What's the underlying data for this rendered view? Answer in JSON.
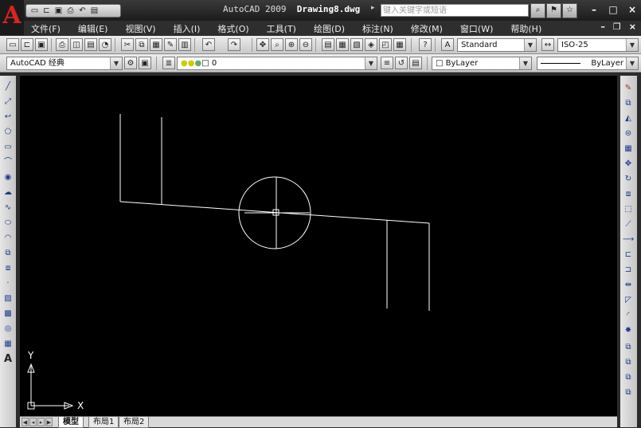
{
  "app": {
    "logo_letter": "A",
    "title_app": "AutoCAD 2009",
    "title_file": "Drawing8.dwg",
    "search_placeholder": "键入关键字或短语"
  },
  "quick_access": [
    "new-icon",
    "open-icon",
    "save-icon",
    "print-icon",
    "undo-icon",
    "plot-icon"
  ],
  "menu": {
    "items": [
      "文件(F)",
      "编辑(E)",
      "视图(V)",
      "插入(I)",
      "格式(O)",
      "工具(T)",
      "绘图(D)",
      "标注(N)",
      "修改(M)",
      "窗口(W)",
      "帮助(H)"
    ]
  },
  "toolbar": {
    "text_style": "Standard",
    "dim_style": "ISO-25",
    "workspace": "AutoCAD 经典",
    "layer": "0",
    "color": "ByLayer",
    "linetype": "ByLayer"
  },
  "tabs": {
    "items": [
      "模型",
      "布局1",
      "布局2"
    ],
    "active": 0
  },
  "ucs": {
    "y_label": "Y",
    "x_label": "X"
  },
  "colors": {
    "canvas": "#000000",
    "geometry": "#ffffff",
    "brand": "#d22222"
  }
}
